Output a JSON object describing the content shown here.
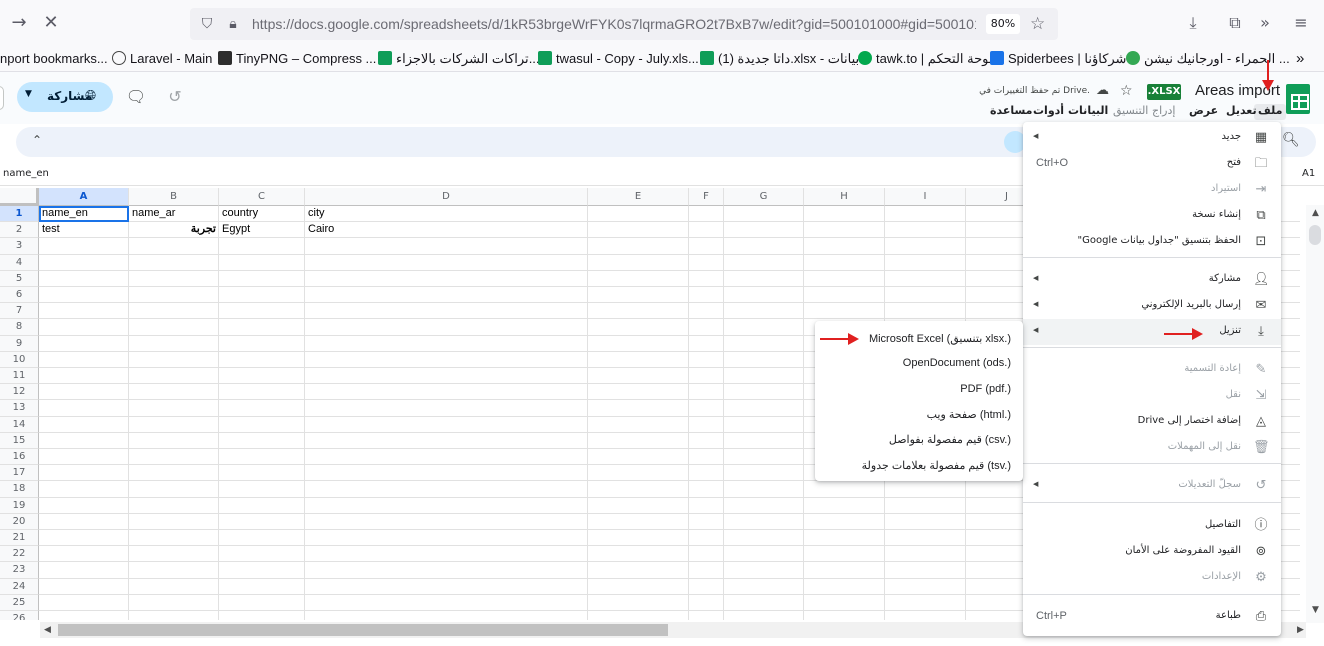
{
  "browser": {
    "url": "https://docs.google.com/spreadsheets/d/1kR53brgeWrFYK0s7lqrmaGRO2t7BxB7w/edit?gid=500101000#gid=500101",
    "zoom": "80%"
  },
  "bookmarks": [
    {
      "label": "nport bookmarks...",
      "icon": "none"
    },
    {
      "label": "Laravel - Main",
      "icon": "globe-icon"
    },
    {
      "label": "TinyPNG – Compress ...",
      "icon": "panda-icon"
    },
    {
      "label": "تراكات الشركات بالاجزاء...",
      "icon": "sheets-icon"
    },
    {
      "label": "twasul - Copy - July.xls...",
      "icon": "sheets-icon"
    },
    {
      "label": "داتا جديدة (1).xlsx - بيانات...",
      "icon": "sheets-icon"
    },
    {
      "label": "tawk.to | لوحة التحكم",
      "icon": "tawk-icon"
    },
    {
      "label": "Spiderbees | شركاؤنا",
      "icon": "spiderbees-icon"
    },
    {
      "label": "الحمراء - اورجانيك نيشن ...",
      "icon": "leaf-icon"
    }
  ],
  "doc": {
    "title": "Areas import",
    "badge": ".XLSX",
    "saved_status": "تم حفظ التغييرات في Drive.",
    "share_label": "مشاركة",
    "menus": [
      "ملف",
      "تعديل",
      "عرض",
      "إدراج",
      "التنسيق",
      "البيانات",
      "أدوات",
      "مساعدة"
    ]
  },
  "formula_bar": {
    "name_box": "A1",
    "content": "name_en"
  },
  "grid": {
    "columns": [
      "A",
      "B",
      "C",
      "D",
      "E",
      "F",
      "G",
      "H",
      "I",
      "J"
    ],
    "rows": [
      "1",
      "2",
      "3",
      "4",
      "5",
      "6",
      "7",
      "8",
      "9",
      "10",
      "11",
      "12",
      "13",
      "14",
      "15",
      "16",
      "17",
      "18",
      "19",
      "20",
      "21",
      "22",
      "23",
      "24",
      "25",
      "26"
    ],
    "cells": [
      [
        "name_en",
        "name_ar",
        "country",
        "city"
      ],
      [
        "test",
        "تجربة",
        "Egypt",
        "Cairo"
      ]
    ]
  },
  "file_menu": [
    {
      "label": "جديد",
      "icon": "new-icon",
      "submenu": true
    },
    {
      "label": "فتح",
      "icon": "folder-icon",
      "shortcut": "Ctrl+O"
    },
    {
      "label": "استيراد",
      "icon": "import-icon",
      "disabled": true
    },
    {
      "label": "إنشاء نسخة",
      "icon": "copy-icon"
    },
    {
      "label": "الحفظ بتنسيق \"جداول بيانات Google\"",
      "icon": "save-icon"
    },
    {
      "label": "مشاركة",
      "icon": "share-person-icon",
      "submenu": true
    },
    {
      "label": "إرسال بالبريد الإلكتروني",
      "icon": "mail-icon",
      "submenu": true
    },
    {
      "label": "تنزيل",
      "icon": "download-icon",
      "submenu": true,
      "highlighted": true
    },
    {
      "label": "إعادة التسمية",
      "icon": "pencil-icon",
      "disabled": true
    },
    {
      "label": "نقل",
      "icon": "move-icon",
      "disabled": true
    },
    {
      "label": "إضافة اختصار إلى Drive",
      "icon": "drive-shortcut-icon"
    },
    {
      "label": "نقل إلى المهملات",
      "icon": "trash-icon",
      "disabled": true
    },
    {
      "label": "سجلّ التعديلات",
      "icon": "history-icon",
      "submenu": true,
      "disabled": true
    },
    {
      "label": "التفاصيل",
      "icon": "info-icon"
    },
    {
      "label": "القيود المفروضة على الأمان",
      "icon": "security-icon"
    },
    {
      "label": "الإعدادات",
      "icon": "settings-icon",
      "disabled": true
    },
    {
      "label": "طباعة",
      "icon": "print-icon",
      "shortcut": "Ctrl+P"
    }
  ],
  "download_submenu": [
    "Microsoft Excel (بتنسيق xlsx.)",
    "OpenDocument (ods.)",
    "PDF (pdf.)",
    "صفحة ويب (html.)",
    "قيم مفصولة بفواصل (csv.)",
    "قيم مفصولة بعلامات جدولة (tsv.)"
  ],
  "colors": {
    "accent": "#1a73e8",
    "share_bg": "#c2e7ff",
    "sheets_green": "#0f9d58",
    "annotation": "#e02020"
  }
}
